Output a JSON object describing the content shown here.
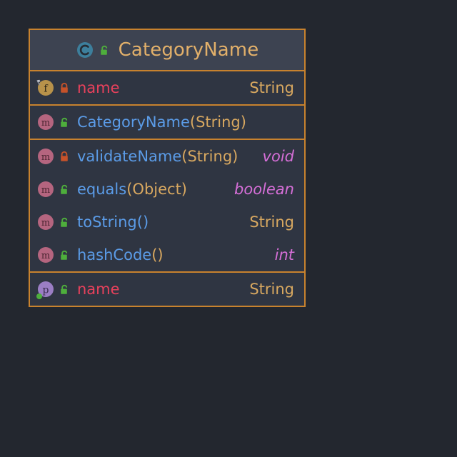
{
  "diagram": {
    "kind": "uml-class-diagram",
    "background_color": "#23272f",
    "accent_border_color": "#c8822e",
    "class": {
      "icon": "class-c-icon",
      "visibility_icon": "unlocked-padlock-green-icon",
      "name": "CategoryName",
      "name_color": "#e2b06a",
      "header_background": "#3d4351",
      "body_background": "#2f3542"
    },
    "sections": [
      {
        "id": "fields",
        "rows": [
          {
            "kind_icon": "field-f-icon",
            "kind_badge_letter": "f",
            "modifier_icon": "final-pin-icon",
            "visibility_icon": "locked-padlock-orange-icon",
            "name": "name",
            "name_color": "#e8415c",
            "params": "",
            "type": "String",
            "type_kind": "reference"
          }
        ]
      },
      {
        "id": "constructors",
        "rows": [
          {
            "kind_icon": "method-m-icon",
            "kind_badge_letter": "m",
            "visibility_icon": "unlocked-padlock-green-icon",
            "name": "CategoryName",
            "name_color": "#5b9ce8",
            "params": "(String)",
            "type": "",
            "type_kind": "none"
          }
        ]
      },
      {
        "id": "methods",
        "rows": [
          {
            "kind_icon": "method-m-icon",
            "kind_badge_letter": "m",
            "visibility_icon": "locked-padlock-orange-icon",
            "name": "validateName",
            "name_color": "#5b9ce8",
            "params": "(String)",
            "type": "void",
            "type_kind": "primitive"
          },
          {
            "kind_icon": "method-m-icon",
            "kind_badge_letter": "m",
            "visibility_icon": "unlocked-padlock-green-icon",
            "name": "equals",
            "name_color": "#5b9ce8",
            "params": "(Object)",
            "type": "boolean",
            "type_kind": "primitive"
          },
          {
            "kind_icon": "method-m-icon",
            "kind_badge_letter": "m",
            "visibility_icon": "unlocked-padlock-green-icon",
            "name": "toString",
            "name_color": "#5b9ce8",
            "params": "()",
            "type": "String",
            "type_kind": "reference"
          },
          {
            "kind_icon": "method-m-icon",
            "kind_badge_letter": "m",
            "visibility_icon": "unlocked-padlock-green-icon",
            "name": "hashCode",
            "name_color": "#5b9ce8",
            "params": "()",
            "type": "int",
            "type_kind": "primitive"
          }
        ]
      },
      {
        "id": "properties",
        "rows": [
          {
            "kind_icon": "property-p-icon",
            "kind_badge_letter": "p",
            "modifier_icon": "getter-dot-icon",
            "visibility_icon": "unlocked-padlock-green-icon",
            "name": "name",
            "name_color": "#e8415c",
            "params": "",
            "type": "String",
            "type_kind": "reference"
          }
        ]
      }
    ]
  }
}
